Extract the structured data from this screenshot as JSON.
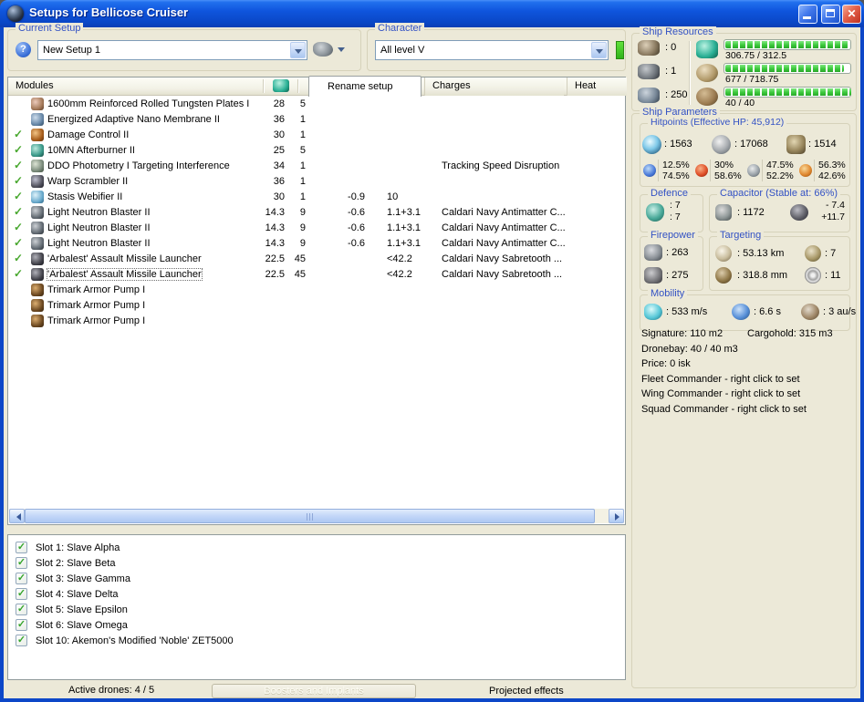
{
  "window": {
    "title": "Setups for Bellicose Cruiser"
  },
  "glyphs": {
    "check": "✓",
    "help": "?",
    "close": "✕"
  },
  "current_setup": {
    "label": "Current Setup",
    "value": "New Setup 1"
  },
  "character": {
    "label": "Character",
    "value": "All level V"
  },
  "modules_panel": {
    "header_label": "Modules",
    "tabs": [
      {
        "label": "Rename setup",
        "active": true
      },
      {
        "label": "Charges",
        "active": false
      },
      {
        "label": "Heat",
        "active": false
      }
    ],
    "rows": [
      {
        "active": false,
        "selected": false,
        "icon": "armor-plate-icon",
        "name": "1600mm Reinforced Rolled Tungsten Plates I",
        "cpu": "28",
        "pg": "5",
        "cap": "",
        "range": "",
        "charge": ""
      },
      {
        "active": false,
        "selected": false,
        "icon": "nano-membrane-icon",
        "name": "Energized Adaptive Nano Membrane II",
        "cpu": "36",
        "pg": "1",
        "cap": "",
        "range": "",
        "charge": ""
      },
      {
        "active": true,
        "selected": false,
        "icon": "damage-control-icon",
        "name": "Damage Control II",
        "cpu": "30",
        "pg": "1",
        "cap": "",
        "range": "",
        "charge": ""
      },
      {
        "active": true,
        "selected": false,
        "icon": "afterburner-icon",
        "name": "10MN Afterburner II",
        "cpu": "25",
        "pg": "5",
        "cap": "",
        "range": "",
        "charge": ""
      },
      {
        "active": true,
        "selected": false,
        "icon": "tracking-disruptor-icon",
        "name": "DDO Photometry I Targeting Interference",
        "cpu": "34",
        "pg": "1",
        "cap": "",
        "range": "",
        "charge": "Tracking Speed Disruption"
      },
      {
        "active": true,
        "selected": false,
        "icon": "warp-scrambler-icon",
        "name": "Warp Scrambler II",
        "cpu": "36",
        "pg": "1",
        "cap": "",
        "range": "",
        "charge": ""
      },
      {
        "active": true,
        "selected": false,
        "icon": "stasis-webifier-icon",
        "name": "Stasis Webifier II",
        "cpu": "30",
        "pg": "1",
        "cap": "-0.9",
        "range": "10",
        "charge": ""
      },
      {
        "active": true,
        "selected": false,
        "icon": "blaster-icon",
        "name": "Light Neutron Blaster II",
        "cpu": "14.3",
        "pg": "9",
        "cap": "-0.6",
        "range": "1.1+3.1",
        "charge": "Caldari Navy Antimatter C..."
      },
      {
        "active": true,
        "selected": false,
        "icon": "blaster-icon",
        "name": "Light Neutron Blaster II",
        "cpu": "14.3",
        "pg": "9",
        "cap": "-0.6",
        "range": "1.1+3.1",
        "charge": "Caldari Navy Antimatter C..."
      },
      {
        "active": true,
        "selected": false,
        "icon": "blaster-icon",
        "name": "Light Neutron Blaster II",
        "cpu": "14.3",
        "pg": "9",
        "cap": "-0.6",
        "range": "1.1+3.1",
        "charge": "Caldari Navy Antimatter C..."
      },
      {
        "active": true,
        "selected": false,
        "icon": "missile-launcher-icon",
        "name": "'Arbalest' Assault Missile Launcher",
        "cpu": "22.5",
        "pg": "45",
        "cap": "",
        "range": "<42.2",
        "charge": "Caldari Navy Sabretooth ..."
      },
      {
        "active": true,
        "selected": true,
        "icon": "missile-launcher-icon",
        "name": "'Arbalest' Assault Missile Launcher",
        "cpu": "22.5",
        "pg": "45",
        "cap": "",
        "range": "<42.2",
        "charge": "Caldari Navy Sabretooth ..."
      },
      {
        "active": false,
        "selected": false,
        "icon": "rig-icon",
        "name": "Trimark Armor Pump I",
        "cpu": "",
        "pg": "",
        "cap": "",
        "range": "",
        "charge": ""
      },
      {
        "active": false,
        "selected": false,
        "icon": "rig-icon",
        "name": "Trimark Armor Pump I",
        "cpu": "",
        "pg": "",
        "cap": "",
        "range": "",
        "charge": ""
      },
      {
        "active": false,
        "selected": false,
        "icon": "rig-icon",
        "name": "Trimark Armor Pump I",
        "cpu": "",
        "pg": "",
        "cap": "",
        "range": "",
        "charge": ""
      }
    ]
  },
  "implants_panel": {
    "items": [
      {
        "checked": true,
        "label": "Slot 1: Slave Alpha"
      },
      {
        "checked": true,
        "label": "Slot 2: Slave Beta"
      },
      {
        "checked": true,
        "label": "Slot 3: Slave Gamma"
      },
      {
        "checked": true,
        "label": "Slot 4: Slave Delta"
      },
      {
        "checked": true,
        "label": "Slot 5: Slave Epsilon"
      },
      {
        "checked": true,
        "label": "Slot 6: Slave Omega"
      },
      {
        "checked": true,
        "label": "Slot 10: Akemon's Modified 'Noble' ZET5000"
      }
    ]
  },
  "bottom_bar": {
    "active_drones": "Active drones: 4 / 5",
    "boosters_button": "Boosters and Implants",
    "projected_effects": "Projected effects"
  },
  "ship_resources": {
    "label": "Ship Resources",
    "slots": [
      {
        "icon": "turret-hardpoint-icon",
        "value": ": 0"
      },
      {
        "icon": "launcher-hardpoint-icon",
        "value": ": 1"
      },
      {
        "icon": "calibration-icon",
        "value": ": 250"
      }
    ],
    "bars": [
      {
        "icon": "cpu-icon",
        "text": "306.75 / 312.5",
        "fill_pct": 98
      },
      {
        "icon": "powergrid-icon",
        "text": "677 / 718.75",
        "fill_pct": 94
      },
      {
        "icon": "dronebay-icon",
        "text": "40 / 40",
        "fill_pct": 100
      }
    ]
  },
  "ship_parameters": {
    "label": "Ship Parameters",
    "hitpoints": {
      "label": "Hitpoints (Effective HP: 45,912)",
      "values": [
        {
          "icon": "shield-icon",
          "value": ": 1563"
        },
        {
          "icon": "armor-icon",
          "value": ": 17068"
        },
        {
          "icon": "structure-icon",
          "value": ": 1514"
        }
      ],
      "resists": [
        {
          "icon": "em-icon",
          "top": "12.5%",
          "bottom": "74.5%"
        },
        {
          "icon": "thermal-icon",
          "top": "30%",
          "bottom": "58.6%"
        },
        {
          "icon": "kinetic-icon",
          "top": "47.5%",
          "bottom": "52.2%"
        },
        {
          "icon": "explosive-icon",
          "top": "56.3%",
          "bottom": "42.6%"
        }
      ]
    },
    "defence": {
      "label": "Defence",
      "icon": "defence-icon",
      "top": ": 7",
      "bottom": ": 7"
    },
    "capacitor": {
      "label": "Capacitor (Stable at: 66%)",
      "amount_icon": "capacitor-icon",
      "amount": ": 1172",
      "delta_icon": "cap-recharge-icon",
      "delta_top": "- 7.4",
      "delta_bottom": "+11.7"
    },
    "firepower": {
      "label": "Firepower",
      "rows": [
        {
          "icon": "turret-dps-icon",
          "value": ": 263"
        },
        {
          "icon": "missile-dps-icon",
          "value": ": 275"
        }
      ]
    },
    "targeting": {
      "label": "Targeting",
      "cells": [
        {
          "icon": "range-icon",
          "value": ": 53.13 km"
        },
        {
          "icon": "sensor-strength-icon",
          "value": ": 7"
        },
        {
          "icon": "scan-res-icon",
          "value": ": 318.8 mm"
        },
        {
          "icon": "max-targets-icon",
          "value": ": 11"
        }
      ]
    },
    "mobility": {
      "label": "Mobility",
      "items": [
        {
          "icon": "speed-icon",
          "value": ": 533 m/s"
        },
        {
          "icon": "agility-icon",
          "value": ": 6.6 s"
        },
        {
          "icon": "warp-speed-icon",
          "value": ": 3 au/s"
        }
      ]
    },
    "stats_lines": [
      {
        "left": "Signature: 110 m2",
        "right": "Cargohold: 315 m3"
      },
      {
        "left": "Dronebay: 40 / 40 m3",
        "right": ""
      },
      {
        "left": "Price: 0 isk",
        "right": ""
      },
      {
        "left": "Fleet Commander - right click to set",
        "right": ""
      },
      {
        "left": "Wing Commander - right click to set",
        "right": ""
      },
      {
        "left": "Squad Commander - right click to set",
        "right": ""
      }
    ]
  },
  "colors": {
    "accent_green": "#3cc83c",
    "label_blue": "#3352c4",
    "titlebar_blue": "#0f55dd",
    "close_red": "#c03222"
  }
}
